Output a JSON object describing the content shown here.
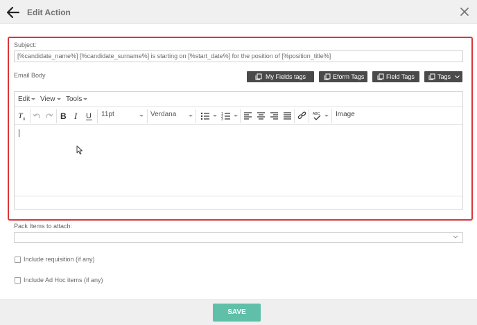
{
  "header": {
    "title": "Edit Action",
    "back_icon": "arrow-left-icon",
    "close_icon": "close-icon"
  },
  "subject": {
    "label": "Subject:",
    "value": "[%candidate_name%] [%candidate_surname%]  is starting on [%start_date%] for the position of [%position_title%]"
  },
  "email_body": {
    "label": "Email Body",
    "tag_buttons": [
      {
        "label": "My Fields tags",
        "icon": "copy-icon"
      },
      {
        "label": "Eform Tags",
        "icon": "copy-icon"
      },
      {
        "label": "Field Tags",
        "icon": "copy-icon"
      },
      {
        "label": "Tags",
        "icon": "copy-icon"
      }
    ]
  },
  "editor": {
    "menu": [
      "Edit",
      "View",
      "Tools"
    ],
    "font_size": "11pt",
    "font_family": "Verdana",
    "image_label": "Image"
  },
  "pack_items": {
    "label": "Pack Items to attach:",
    "value": ""
  },
  "options": [
    {
      "label": "Include requisition (if any)",
      "checked": false
    },
    {
      "label": "Include Ad Hoc items (if any)",
      "checked": false
    }
  ],
  "footer": {
    "save_label": "SAVE"
  },
  "colors": {
    "highlight_border": "#d9353a",
    "save_button": "#5fbfa8",
    "tag_button": "#4a4a4a",
    "header_bg": "#f0f0f0"
  }
}
